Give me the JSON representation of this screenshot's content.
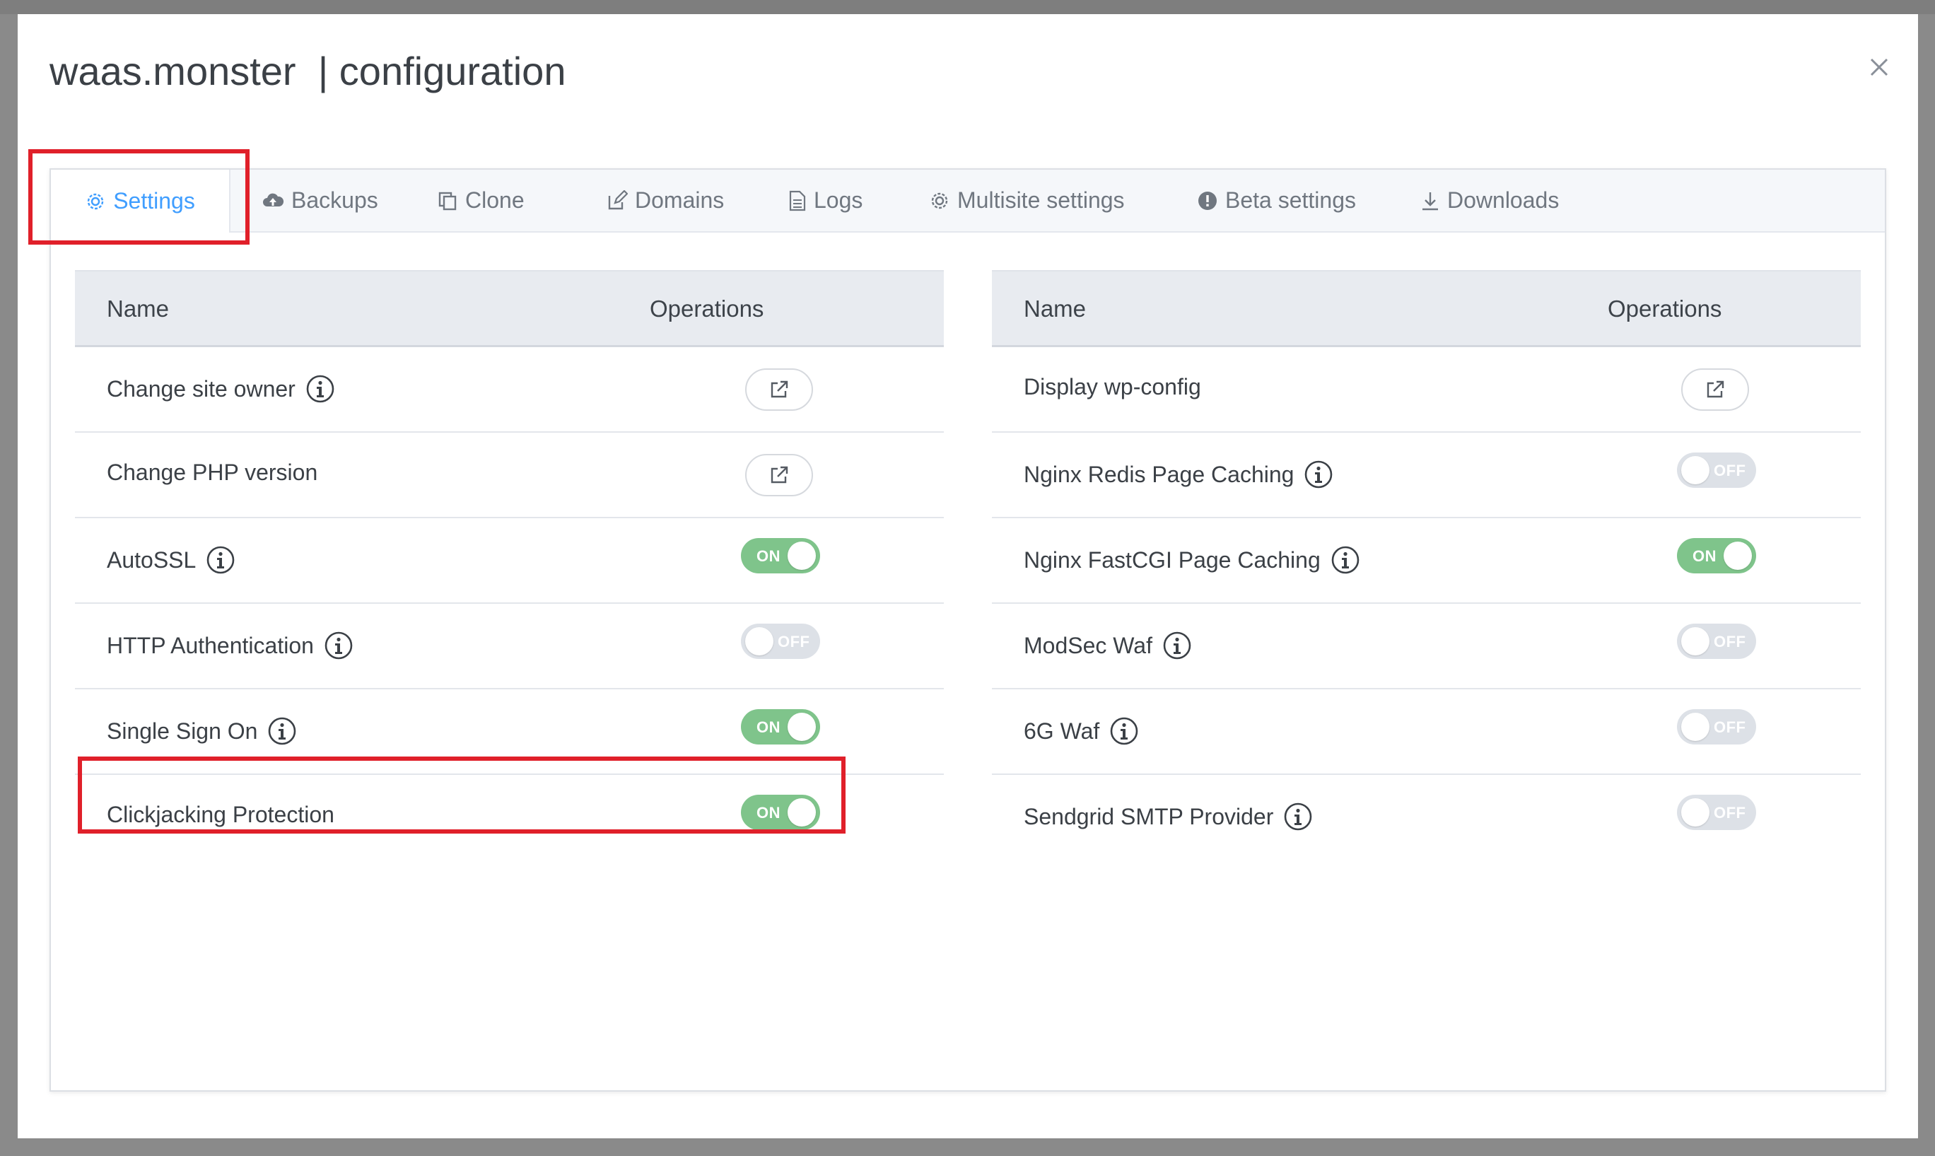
{
  "modal": {
    "title": "waas.monster  | configuration",
    "close_icon": "close-icon"
  },
  "tabs": [
    {
      "label": "Settings",
      "icon": "gear-icon",
      "active": true
    },
    {
      "label": "Backups",
      "icon": "cloud-upload-icon",
      "active": false
    },
    {
      "label": "Clone",
      "icon": "copy-icon",
      "active": false
    },
    {
      "label": "Domains",
      "icon": "edit-icon",
      "active": false
    },
    {
      "label": "Logs",
      "icon": "document-icon",
      "active": false
    },
    {
      "label": "Multisite settings",
      "icon": "gear-icon",
      "active": false
    },
    {
      "label": "Beta settings",
      "icon": "warning-icon",
      "active": false
    },
    {
      "label": "Downloads",
      "icon": "download-icon",
      "active": false
    }
  ],
  "left_table": {
    "header_name": "Name",
    "header_ops": "Operations",
    "rows": [
      {
        "label": "Change site owner",
        "info": true,
        "control": "link"
      },
      {
        "label": "Change PHP version",
        "info": false,
        "control": "link"
      },
      {
        "label": "AutoSSL",
        "info": true,
        "control": "switch",
        "state": "ON"
      },
      {
        "label": "HTTP Authentication",
        "info": true,
        "control": "switch",
        "state": "OFF"
      },
      {
        "label": "Single Sign On",
        "info": true,
        "control": "switch",
        "state": "ON"
      },
      {
        "label": "Clickjacking Protection",
        "info": false,
        "control": "switch",
        "state": "ON"
      }
    ]
  },
  "right_table": {
    "header_name": "Name",
    "header_ops": "Operations",
    "rows": [
      {
        "label": "Display wp-config",
        "info": false,
        "control": "link"
      },
      {
        "label": "Nginx Redis Page Caching",
        "info": true,
        "control": "switch",
        "state": "OFF"
      },
      {
        "label": "Nginx FastCGI Page Caching",
        "info": true,
        "control": "switch",
        "state": "ON"
      },
      {
        "label": "ModSec Waf",
        "info": true,
        "control": "switch",
        "state": "OFF"
      },
      {
        "label": "6G Waf",
        "info": true,
        "control": "switch",
        "state": "OFF"
      },
      {
        "label": "Sendgrid SMTP Provider",
        "info": true,
        "control": "switch",
        "state": "OFF"
      }
    ]
  },
  "colors": {
    "accent": "#409eff",
    "switch_on": "#7fc48b",
    "switch_off": "#dde1e7",
    "highlight": "#e0202a"
  }
}
